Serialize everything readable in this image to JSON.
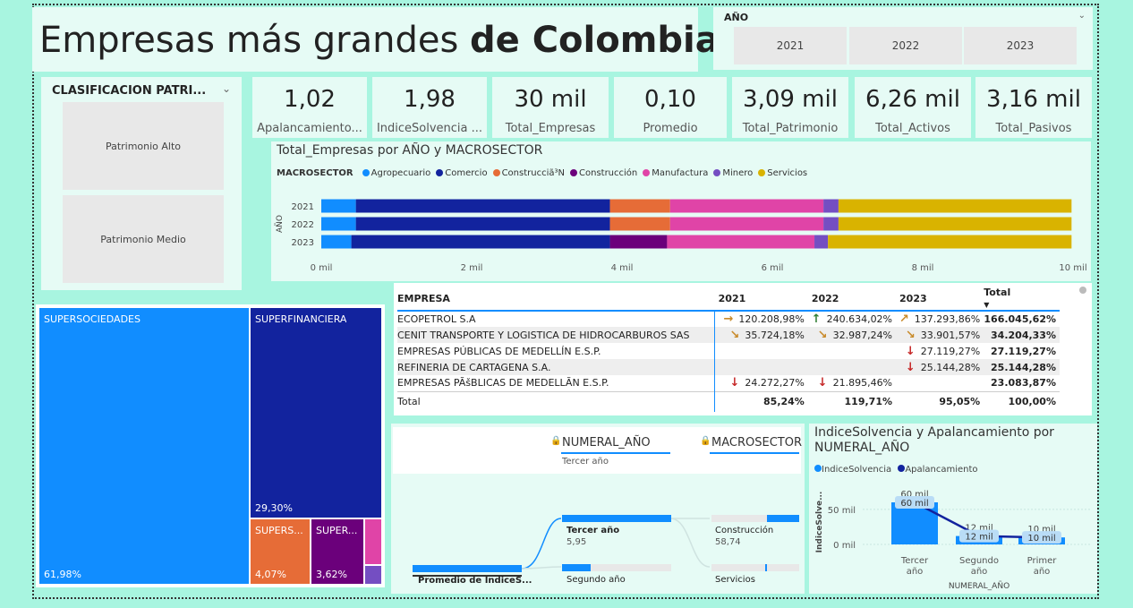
{
  "page": {
    "title_regular": "Empresas más grandes ",
    "title_bold": "de Colombia"
  },
  "year_slicer": {
    "label": "AÑO",
    "options": [
      "2021",
      "2022",
      "2023"
    ]
  },
  "clasificacion": {
    "label": "CLASIFICACION PATRI...",
    "options": [
      "Patrimonio Alto",
      "Patrimonio Medio"
    ]
  },
  "kpis": [
    {
      "value": "1,02",
      "label": "Apalancamiento..."
    },
    {
      "value": "1,98",
      "label": "IndiceSolvencia ..."
    },
    {
      "value": "30 mil",
      "label": "Total_Empresas"
    },
    {
      "value": "0,10",
      "label": "Promedio"
    },
    {
      "value": "3,09 mil",
      "label": "Total_Patrimonio"
    },
    {
      "value": "6,26 mil",
      "label": "Total_Activos"
    },
    {
      "value": "3,16 mil",
      "label": "Total_Pasivos"
    }
  ],
  "bar_chart": {
    "title": "Total_Empresas por AÑO y MACROSECTOR",
    "legend_title": "MACROSECTOR",
    "ylabel": "AÑO",
    "x_ticks": [
      "0 mil",
      "2 mil",
      "4 mil",
      "6 mil",
      "8 mil",
      "10 mil"
    ]
  },
  "chart_data": {
    "type": "bar",
    "orientation": "horizontal-stacked",
    "title": "Total_Empresas por AÑO y MACROSECTOR",
    "ylabel": "AÑO",
    "categories": [
      "2021",
      "2022",
      "2023"
    ],
    "xlim": [
      0,
      10000
    ],
    "legend_placement": "top-left",
    "series": [
      {
        "name": "Agropecuario",
        "color": "#118dff",
        "values": [
          460,
          460,
          400
        ]
      },
      {
        "name": "Comercio",
        "color": "#12239e",
        "values": [
          3380,
          3380,
          3440
        ]
      },
      {
        "name": "Construcciã³N",
        "color": "#e66c37",
        "values": [
          800,
          800,
          0
        ]
      },
      {
        "name": "Construcción",
        "color": "#6b007b",
        "values": [
          0,
          0,
          760
        ]
      },
      {
        "name": "Manufactura",
        "color": "#e044a7",
        "values": [
          2040,
          2040,
          1960
        ]
      },
      {
        "name": "Minero",
        "color": "#744ec2",
        "values": [
          200,
          200,
          180
        ]
      },
      {
        "name": "Servicios",
        "color": "#d9b300",
        "values": [
          3100,
          3100,
          3240
        ]
      }
    ]
  },
  "treemap": {
    "tiles": [
      {
        "name": "SUPERSOCIEDADES",
        "pct": "61,98%",
        "color": "#118dff"
      },
      {
        "name": "SUPERFINANCIERA",
        "pct": "29,30%",
        "color": "#12239e"
      },
      {
        "name": "SUPERS...",
        "pct": "4,07%",
        "color": "#e66c37"
      },
      {
        "name": "SUPER...",
        "pct": "3,62%",
        "color": "#6b007b"
      },
      {
        "name": "",
        "pct": "",
        "color": "#e044a7"
      },
      {
        "name": "",
        "pct": "",
        "color": "#744ec2"
      }
    ]
  },
  "table": {
    "headers": [
      "EMPRESA",
      "2021",
      "2022",
      "2023",
      "Total"
    ],
    "rows": [
      {
        "empresa": "ECOPETROL S.A",
        "y2021": "120.208,98%",
        "y2022": "240.634,02%",
        "y2023": "137.293,86%",
        "total": "166.045,62%",
        "a2021": "→",
        "c2021": "#c88a2a",
        "a2022": "↑",
        "c2022": "#2e7d32",
        "a2023": "↗",
        "c2023": "#c88a2a"
      },
      {
        "empresa": "CENIT TRANSPORTE Y LOGISTICA DE HIDROCARBUROS SAS",
        "y2021": "35.724,18%",
        "y2022": "32.987,24%",
        "y2023": "33.901,57%",
        "total": "34.204,33%",
        "a2021": "↘",
        "c2021": "#c88a2a",
        "a2022": "↘",
        "c2022": "#c88a2a",
        "a2023": "↘",
        "c2023": "#c88a2a"
      },
      {
        "empresa": "EMPRESAS PÚBLICAS DE MEDELLÍN E.S.P.",
        "y2021": "",
        "y2022": "",
        "y2023": "27.119,27%",
        "total": "27.119,27%",
        "a2021": "",
        "c2021": "",
        "a2022": "",
        "c2022": "",
        "a2023": "↓",
        "c2023": "#c62828"
      },
      {
        "empresa": "REFINERIA DE CARTAGENA S.A.",
        "y2021": "",
        "y2022": "",
        "y2023": "25.144,28%",
        "total": "25.144,28%",
        "a2021": "",
        "c2021": "",
        "a2022": "",
        "c2022": "",
        "a2023": "↓",
        "c2023": "#c62828"
      },
      {
        "empresa": "EMPRESAS PÃšBLICAS DE MEDELLÃ­N E.S.P.",
        "y2021": "24.272,27%",
        "y2022": "21.895,46%",
        "y2023": "",
        "total": "23.083,87%",
        "a2021": "↓",
        "c2021": "#c62828",
        "a2022": "↓",
        "c2022": "#c62828",
        "a2023": "",
        "c2023": ""
      }
    ],
    "total_row": {
      "label": "Total",
      "y2021": "85,24%",
      "y2022": "119,71%",
      "y2023": "95,05%",
      "total": "100,00%"
    }
  },
  "decomposition": {
    "level1": "NUMERAL_AÑO",
    "level1_sub": "Tercer año",
    "level2": "MACROSECTOR",
    "root_label": "Promedio de IndiceS...",
    "nodes1": [
      {
        "label": "Tercer año",
        "value": "5,95"
      },
      {
        "label": "Segundo año",
        "value": ""
      }
    ],
    "nodes2": [
      {
        "label": "Construcción",
        "value": "58,74"
      },
      {
        "label": "Servicios",
        "value": ""
      }
    ]
  },
  "solvency_chart": {
    "title": "IndiceSolvencia y Apalancamiento por NUMERAL_AÑO",
    "ylabel": "IndiceSolve...",
    "xlabel": "NUMERAL_AÑO",
    "y_ticks": [
      "50 mil",
      "0 mil"
    ],
    "legend": [
      "IndiceSolvencia",
      "Apalancamiento"
    ],
    "categories": [
      "Tercer año",
      "Segundo año",
      "Primer año"
    ],
    "bar_labels": [
      "60 mil",
      "12 mil",
      "10 mil"
    ],
    "line_labels": [
      "60 mil",
      "12 mil",
      "10 mil"
    ]
  },
  "solvency_data": {
    "type": "bar+line",
    "categories": [
      "Tercer año",
      "Segundo año",
      "Primer año"
    ],
    "series": [
      {
        "name": "IndiceSolvencia",
        "color": "#118dff",
        "values": [
          60000,
          12000,
          10000
        ]
      },
      {
        "name": "Apalancamiento",
        "color": "#12239e",
        "values": [
          60000,
          12000,
          10000
        ]
      }
    ],
    "ylim": [
      0,
      65000
    ]
  }
}
